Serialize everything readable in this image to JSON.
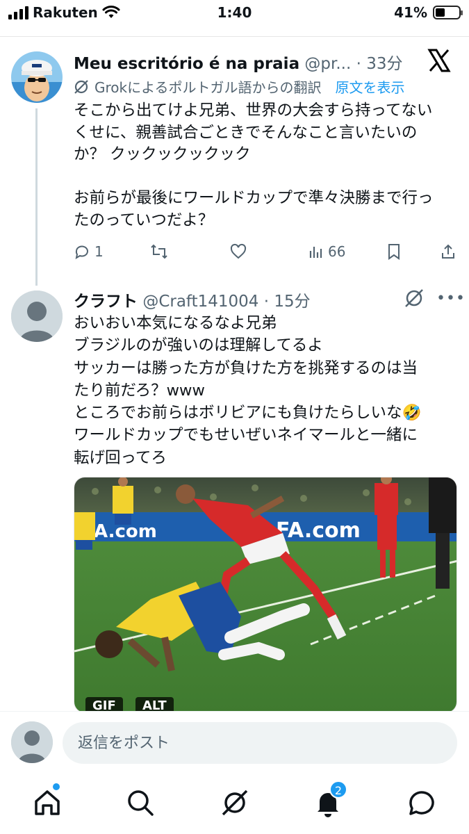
{
  "status_bar": {
    "carrier": "Rakuten",
    "time": "1:40",
    "battery": "41%",
    "battery_level": 0.41
  },
  "tweet1": {
    "author": "Meu escritório é na praia",
    "handle": "@pr...",
    "time": "33分",
    "translation_note": "Grokによるポルトガル語からの翻訳",
    "show_original": "原文を表示",
    "body_lines": [
      "そこから出てけよ兄弟、世界の大会すら持ってない",
      "くせに、親善試合ごときでそんなこと言いたいの",
      "か？ クックックックック",
      "お前らが最後にワールドカップで準々決勝まで行っ",
      "たのっていつだよ？"
    ],
    "replies": "1",
    "views": "66"
  },
  "tweet2": {
    "author": "クラフト",
    "handle": "@Craft141004",
    "time": "15分",
    "body_lines": [
      "おいおい本気になるなよ兄弟",
      "ブラジルのが強いのは理解してるよ",
      "サッカーは勝った方が負けた方を挑発するのは当",
      "たり前だろ？www",
      "ところでお前らはボリビアにも負けたらしいな🤣",
      "ワールドカップでもせいぜいネイマールと一緒に",
      "転げ回ってろ"
    ],
    "media_badges": [
      "GIF",
      "ALT"
    ],
    "banner_text": [
      "A.com",
      "FA.com"
    ]
  },
  "reply_bar": {
    "placeholder": "返信をポスト"
  },
  "nav": {
    "notification_count": "2"
  },
  "colors": {
    "accent": "#1d9bf0",
    "text": "#0f1419",
    "muted": "#536471"
  },
  "icons": [
    "x-logo-icon",
    "grok-icon",
    "reply-icon",
    "repost-icon",
    "like-icon",
    "views-icon",
    "bookmark-icon",
    "share-icon",
    "more-icon",
    "home-icon",
    "search-icon",
    "grok-nav-icon",
    "bell-icon",
    "messages-icon"
  ]
}
